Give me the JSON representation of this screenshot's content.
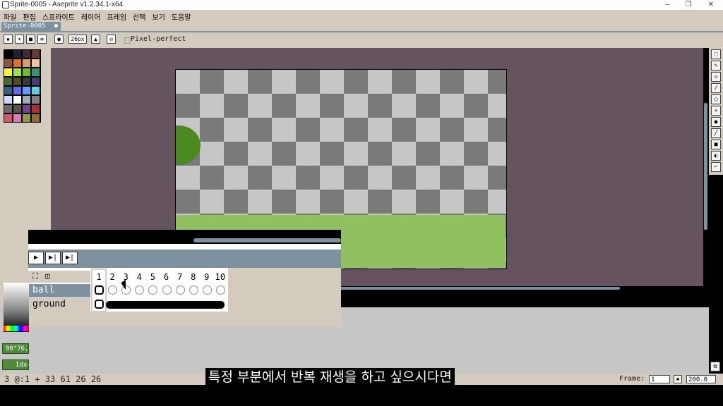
{
  "window": {
    "title": "Sprite-0005 - Aseprite v1.2.34.1-x64",
    "controls": [
      "–",
      "❐",
      "✕"
    ]
  },
  "menu": [
    "파일",
    "편집",
    "스프라이트",
    "레이어",
    "프레임",
    "선택",
    "보기",
    "도움말"
  ],
  "doc_tab": {
    "label": "Sprite-0005"
  },
  "toolbar": {
    "brush_size": "26px",
    "pixel_perfect": "Pixel-perfect"
  },
  "palette_colors": [
    "#000000",
    "#222034",
    "#45283c",
    "#663931",
    "#8f563b",
    "#df7126",
    "#d9a066",
    "#eec39a",
    "#fbf236",
    "#99e550",
    "#6abe30",
    "#37946e",
    "#4b692f",
    "#524b24",
    "#323c39",
    "#3f3f74",
    "#306082",
    "#5b6ee1",
    "#639bff",
    "#5fcde4",
    "#cbdbfc",
    "#ffffff",
    "#9badb7",
    "#847e87",
    "#696a6a",
    "#595652",
    "#76428a",
    "#ac3232",
    "#d95763",
    "#d77bba",
    "#8f974a",
    "#8a6f30"
  ],
  "timeline": {
    "play_buttons": [
      "▶",
      "▶|",
      "▶|"
    ],
    "frames": [
      "1",
      "2",
      "3",
      "4",
      "5",
      "6",
      "7",
      "8",
      "9",
      "10"
    ],
    "layers": [
      {
        "name": "ball"
      },
      {
        "name": "ground"
      }
    ]
  },
  "color": {
    "readout": "90°76,",
    "index": "Idx-"
  },
  "status": {
    "left": "3 @:1  +  33 61   26  26",
    "frame_label": "Frame:",
    "frame_value": "1",
    "zoom": "200.0"
  },
  "subtitle": "특정 부분에서 반복 재생을 하고 싶으시다면"
}
